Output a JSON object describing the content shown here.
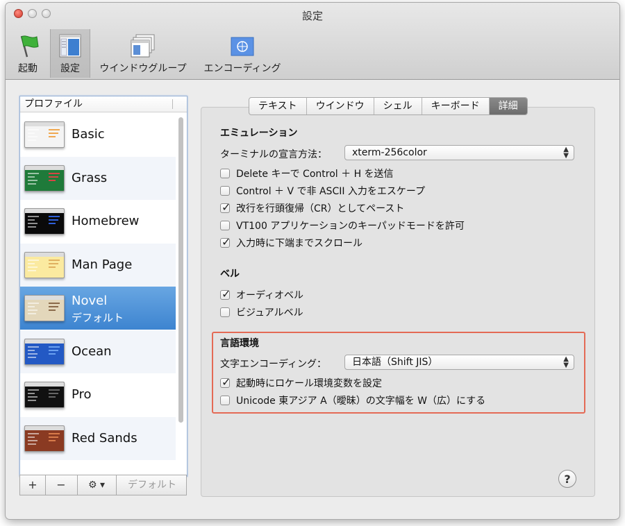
{
  "window": {
    "title": "設定"
  },
  "toolbar": {
    "items": [
      {
        "label": "起動",
        "icon": "green-flag-icon"
      },
      {
        "label": "設定",
        "icon": "settings-list-icon"
      },
      {
        "label": "ウインドウグループ",
        "icon": "window-group-icon"
      },
      {
        "label": "エンコーディング",
        "icon": "un-flag-icon"
      }
    ],
    "selected": "設定"
  },
  "profiles": {
    "header": "プロファイル",
    "items": [
      {
        "name": "Basic",
        "colors": {
          "bg": "#f4f4f4",
          "accent": "#f0a850"
        }
      },
      {
        "name": "Grass",
        "colors": {
          "bg": "#1f7a3a",
          "accent": "#d64545"
        }
      },
      {
        "name": "Homebrew",
        "colors": {
          "bg": "#0a0a0a",
          "accent": "#2f5fd8"
        }
      },
      {
        "name": "Man Page",
        "colors": {
          "bg": "#fbeaa0",
          "accent": "#e0b060"
        }
      },
      {
        "name": "Novel",
        "subtitle": "デフォルト",
        "colors": {
          "bg": "#e3d7bb",
          "accent": "#8a6a4a"
        }
      },
      {
        "name": "Ocean",
        "colors": {
          "bg": "#2359c4",
          "accent": "#6aa0f0"
        }
      },
      {
        "name": "Pro",
        "colors": {
          "bg": "#111111",
          "accent": "#666666"
        }
      },
      {
        "name": "Red Sands",
        "colors": {
          "bg": "#8a3a22",
          "accent": "#d77b4a"
        }
      }
    ],
    "selected": "Novel",
    "footer": {
      "add": "+",
      "remove": "−",
      "gear": "⚙ ▾",
      "default_label": "デフォルト"
    }
  },
  "tabs": {
    "items": [
      "テキスト",
      "ウインドウ",
      "シェル",
      "キーボード",
      "詳細"
    ],
    "selected": "詳細"
  },
  "emulation": {
    "section": "エミュレーション",
    "terminal_label": "ターミナルの宣言方法：",
    "terminal_value": "xterm-256color",
    "options": [
      {
        "label": "Delete キーで Control ＋ H を送信",
        "checked": false
      },
      {
        "label": "Control ＋ V で非 ASCII 入力をエスケープ",
        "checked": false
      },
      {
        "label": "改行を行頭復帰（CR）としてペースト",
        "checked": true
      },
      {
        "label": "VT100 アプリケーションのキーパッドモードを許可",
        "checked": false
      },
      {
        "label": "入力時に下端までスクロール",
        "checked": true
      }
    ]
  },
  "bell": {
    "section": "ベル",
    "options": [
      {
        "label": "オーディオベル",
        "checked": true
      },
      {
        "label": "ビジュアルベル",
        "checked": false
      }
    ]
  },
  "language": {
    "section": "言語環境",
    "encoding_label": "文字エンコーディング：",
    "encoding_value": "日本語（Shift JIS）",
    "options": [
      {
        "label": "起動時にロケール環境変数を設定",
        "checked": true
      },
      {
        "label": "Unicode 東アジア A（曖昧）の文字幅を W（広）にする",
        "checked": false
      }
    ]
  },
  "help": {
    "label": "?"
  }
}
